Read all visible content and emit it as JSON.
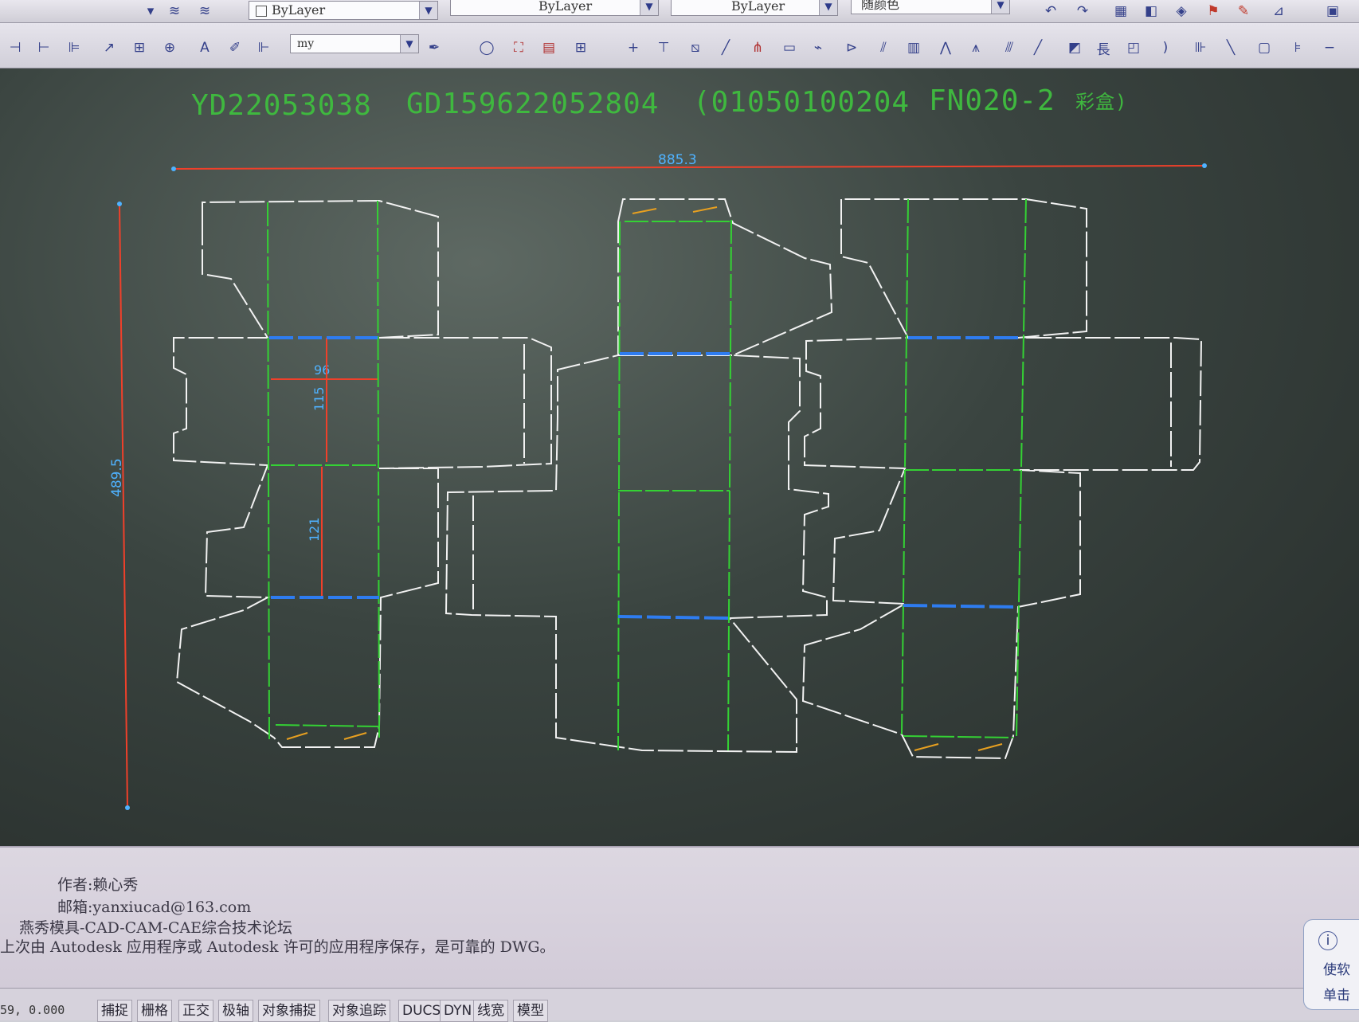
{
  "toolbar": {
    "layer_combo": "ByLayer",
    "linetype_combo": "ByLayer",
    "lineweight_combo": "ByLayer",
    "color_combo": "随颜色",
    "dimstyle_combo": "my"
  },
  "drawing": {
    "title_codes": [
      "YD22053038",
      "GD159622052804",
      "(01050100204",
      "FN020-2"
    ],
    "title_suffix": "彩盒)",
    "dims": {
      "overall_width": "885.3",
      "overall_height": "489.5",
      "panel_width": "96",
      "panel_height_top": "115",
      "panel_height_bottom": "121"
    },
    "colors": {
      "cut_line": "#f2f2f2",
      "crease_line": "#34d234",
      "perforation": "#2e7cf0",
      "dimension": "#f0402a",
      "dim_text": "#4fb2ff",
      "glue_mark": "#e8a020",
      "title": "#3fb83f"
    }
  },
  "command_history": [
    "作者:赖心秀",
    "邮箱:yanxiucad@163.com",
    "燕秀模具-CAD-CAM-CAE综合技术论坛",
    "上次由 Autodesk 应用程序或 Autodesk 许可的应用程序保存，是可靠的 DWG。"
  ],
  "status_bar": {
    "coordinates": "59, 0.000",
    "toggles": [
      "捕捉",
      "栅格",
      "正交",
      "极轴",
      "对象捕捉",
      "对象追踪",
      "DUCS",
      "DYN",
      "线宽",
      "模型"
    ]
  },
  "notification": {
    "lines": [
      "i",
      "使软",
      "单击"
    ]
  }
}
